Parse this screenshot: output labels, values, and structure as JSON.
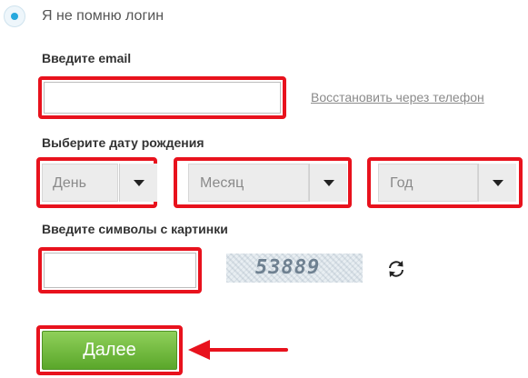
{
  "recovery_option": {
    "label": "Я не помню логин",
    "selected": true
  },
  "email": {
    "label": "Введите email",
    "value": "",
    "restore_link": "Восстановить через телефон"
  },
  "birthdate": {
    "label": "Выберите дату рождения",
    "day": "День",
    "month": "Месяц",
    "year": "Год"
  },
  "captcha": {
    "label": "Введите символы с картинки",
    "value": "",
    "image_text": "53889"
  },
  "submit": {
    "label": "Далее"
  },
  "colors": {
    "highlight": "#e8121d",
    "button": "#6dbb3a",
    "radio": "#26a8dd"
  }
}
